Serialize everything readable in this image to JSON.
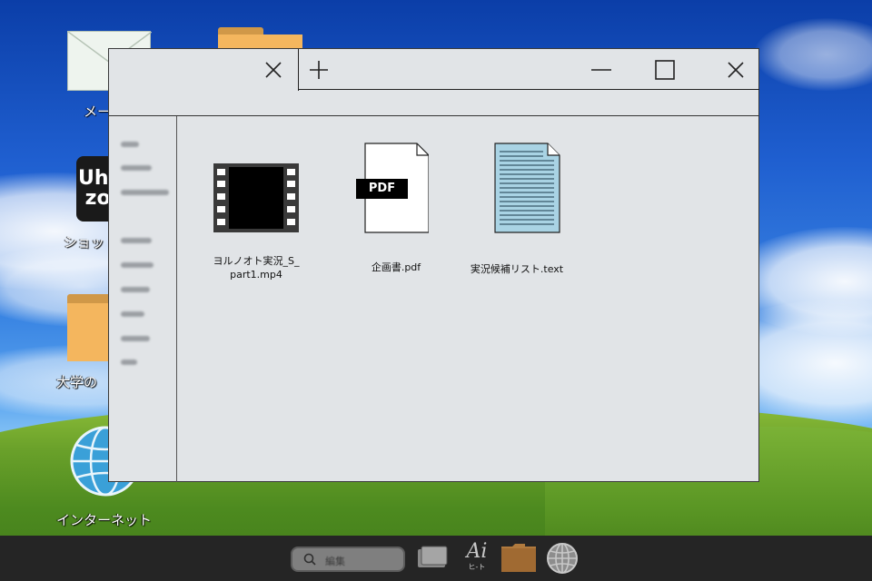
{
  "desktop": {
    "icons": [
      {
        "label": "メー"
      },
      {
        "label": ""
      },
      {
        "label": "ショッ"
      },
      {
        "label": "大学の"
      },
      {
        "label": "インターネット"
      }
    ]
  },
  "uh_icon_text": "Uh\nzo",
  "window": {
    "controls": {
      "close_tab": "×",
      "new_tab": "+",
      "minimize": "–",
      "maximize": "□",
      "close_window": "×"
    },
    "files": [
      {
        "name_line1": "ヨルノオト実況_S_",
        "name_line2": "part1.mp4",
        "icon": "video-file-icon"
      },
      {
        "name_line1": "企画書.pdf",
        "name_line2": "",
        "icon": "pdf-file-icon",
        "badge": "PDF"
      },
      {
        "name_line1": "実況候補リスト.text",
        "name_line2": "",
        "icon": "text-file-icon"
      }
    ]
  },
  "taskbar": {
    "search_placeholder": "編集",
    "ai_label": "Ai",
    "ai_sub": "ヒ-ト"
  },
  "colors": {
    "window_bg": "#e1e4e7",
    "taskbar_bg": "#252525",
    "folder": "#f4b65e",
    "text_file": "#a9d3e4"
  }
}
